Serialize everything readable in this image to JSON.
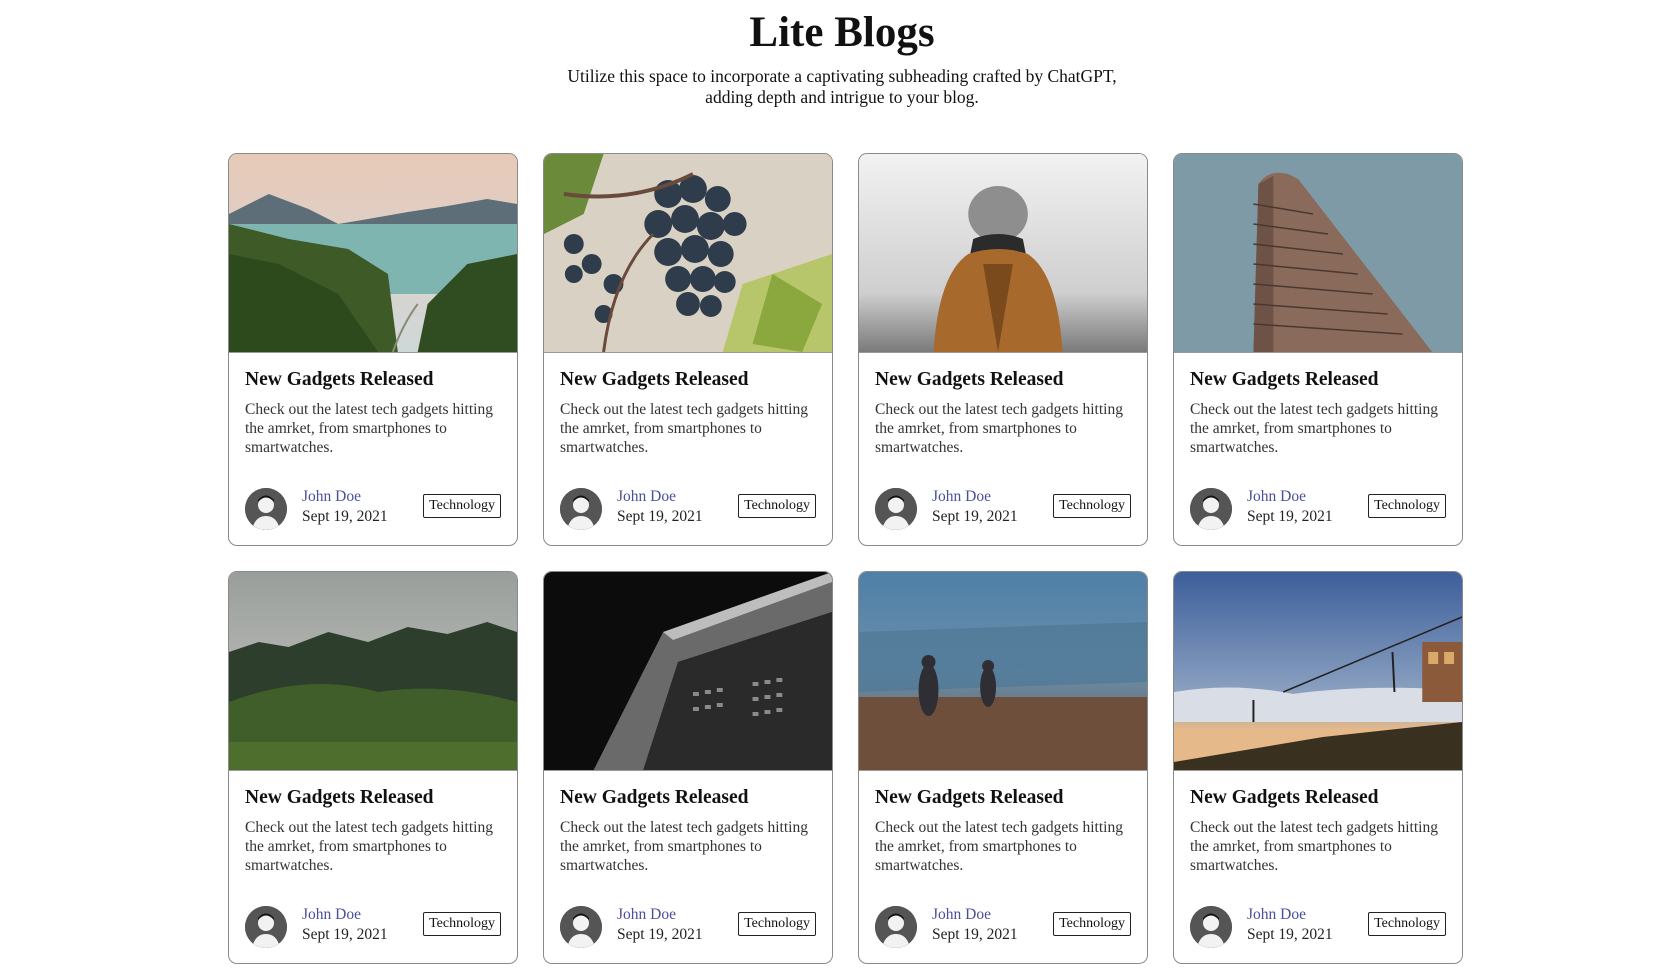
{
  "header": {
    "title": "Lite Blogs",
    "subtitle_line1": "Utilize this space to incorporate a captivating subheading crafted by ChatGPT,",
    "subtitle_line2": "adding depth and intrigue to your blog."
  },
  "cards": [
    {
      "image": "lake-mountains-photo",
      "title": "New Gadgets Released",
      "description": "Check out the latest tech gadgets hitting the amrket, from smartphones to smartwatches.",
      "author": "John Doe",
      "date": "Sept 19, 2021",
      "tag": "Technology"
    },
    {
      "image": "grapes-vine-photo",
      "title": "New Gadgets Released",
      "description": "Check out the latest tech gadgets hitting the amrket, from smartphones to smartwatches.",
      "author": "John Doe",
      "date": "Sept 19, 2021",
      "tag": "Technology"
    },
    {
      "image": "person-in-fog-photo",
      "title": "New Gadgets Released",
      "description": "Check out the latest tech gadgets hitting the amrket, from smartphones to smartwatches.",
      "author": "John Doe",
      "date": "Sept 19, 2021",
      "tag": "Technology"
    },
    {
      "image": "flatiron-building-photo",
      "title": "New Gadgets Released",
      "description": "Check out the latest tech gadgets hitting the amrket, from smartphones to smartwatches.",
      "author": "John Doe",
      "date": "Sept 19, 2021",
      "tag": "Technology"
    },
    {
      "image": "foggy-forest-hills-photo",
      "title": "New Gadgets Released",
      "description": "Check out the latest tech gadgets hitting the amrket, from smartphones to smartwatches.",
      "author": "John Doe",
      "date": "Sept 19, 2021",
      "tag": "Technology"
    },
    {
      "image": "dark-skyscraper-photo",
      "title": "New Gadgets Released",
      "description": "Check out the latest tech gadgets hitting the amrket, from smartphones to smartwatches.",
      "author": "John Doe",
      "date": "Sept 19, 2021",
      "tag": "Technology"
    },
    {
      "image": "misty-field-people-photo",
      "title": "New Gadgets Released",
      "description": "Check out the latest tech gadgets hitting the amrket, from smartphones to smartwatches.",
      "author": "John Doe",
      "date": "Sept 19, 2021",
      "tag": "Technology"
    },
    {
      "image": "ski-lift-sunset-photo",
      "title": "New Gadgets Released",
      "description": "Check out the latest tech gadgets hitting the amrket, from smartphones to smartwatches.",
      "author": "John Doe",
      "date": "Sept 19, 2021",
      "tag": "Technology"
    }
  ],
  "colors": {
    "author_link": "#4b4f9a",
    "card_border": "#8a8a8a",
    "text": "#111111"
  }
}
